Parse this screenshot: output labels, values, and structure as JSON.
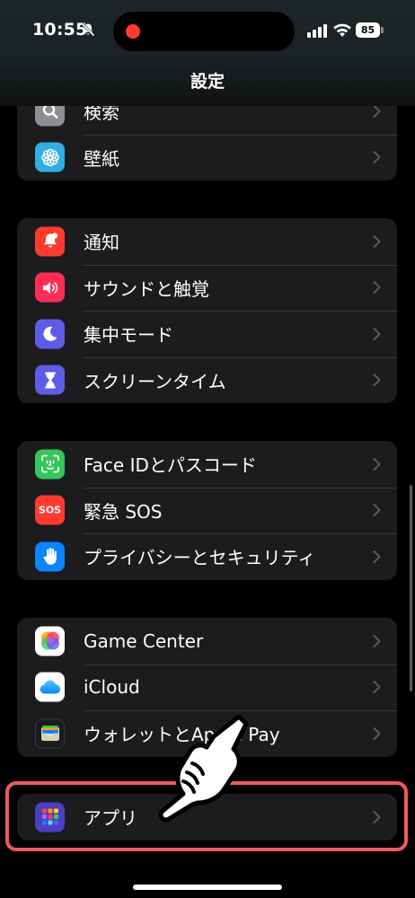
{
  "status_bar": {
    "time": "10:55",
    "battery": "85"
  },
  "nav": {
    "title": "設定"
  },
  "groups": [
    {
      "items": [
        {
          "label": "検索",
          "icon": "search-icon"
        },
        {
          "label": "壁紙",
          "icon": "wallpaper-flower-icon"
        }
      ]
    },
    {
      "items": [
        {
          "label": "通知",
          "icon": "bell-notification-icon"
        },
        {
          "label": "サウンドと触覚",
          "icon": "speaker-icon"
        },
        {
          "label": "集中モード",
          "icon": "moon-icon"
        },
        {
          "label": "スクリーンタイム",
          "icon": "hourglass-icon"
        }
      ]
    },
    {
      "items": [
        {
          "label": "Face IDとパスコード",
          "icon": "face-id-icon"
        },
        {
          "label": "緊急 SOS",
          "icon": "sos-icon",
          "icon_text": "SOS"
        },
        {
          "label": "プライバシーとセキュリティ",
          "icon": "hand-icon"
        }
      ]
    },
    {
      "items": [
        {
          "label": "Game Center",
          "icon": "game-center-icon"
        },
        {
          "label": "iCloud",
          "icon": "cloud-icon"
        },
        {
          "label": "ウォレットとApple Pay",
          "icon": "wallet-icon"
        }
      ]
    },
    {
      "items": [
        {
          "label": "アプリ",
          "icon": "apps-grid-icon"
        }
      ]
    }
  ],
  "colors": {
    "background": "#000000",
    "group_bg": "#1c1c1e",
    "highlight": "#f05a5f",
    "notifications": "#ff3b30",
    "sounds": "#ff2d55",
    "focus": "#5e5ce6",
    "screen_time": "#5e5ce6",
    "face_id": "#34c759",
    "sos": "#ff3b30",
    "privacy": "#0a84ff",
    "wallpaper": "#32ade6"
  }
}
